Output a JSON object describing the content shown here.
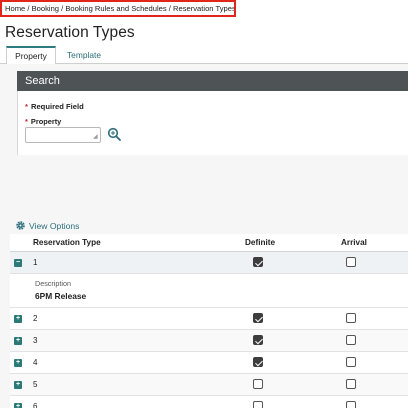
{
  "breadcrumb": "Home / Booking / Booking Rules and Schedules / Reservation Types",
  "page_title": "Reservation Types",
  "tabs": [
    {
      "label": "Property",
      "active": true
    },
    {
      "label": "Template",
      "active": false
    }
  ],
  "search": {
    "header": "Search",
    "required_note": "Required Field",
    "property_label": "Property",
    "property_value": ""
  },
  "view_options_label": "View Options",
  "grid": {
    "columns": [
      "Reservation Type",
      "Definite",
      "Arrival"
    ],
    "rows": [
      {
        "type": "1",
        "definite": true,
        "arrival": false,
        "expanded": true,
        "description_label": "Description",
        "description": "6PM Release"
      },
      {
        "type": "2",
        "definite": true,
        "arrival": false,
        "expanded": false
      },
      {
        "type": "3",
        "definite": true,
        "arrival": false,
        "expanded": false
      },
      {
        "type": "4",
        "definite": true,
        "arrival": false,
        "expanded": false
      },
      {
        "type": "5",
        "definite": false,
        "arrival": false,
        "expanded": false
      },
      {
        "type": "6",
        "definite": false,
        "arrival": false,
        "expanded": false
      }
    ]
  },
  "colors": {
    "accent": "#2c7b7e",
    "search_header_bg": "#4e5356",
    "highlight_border": "#e0251b",
    "required_star": "#c8202b"
  }
}
